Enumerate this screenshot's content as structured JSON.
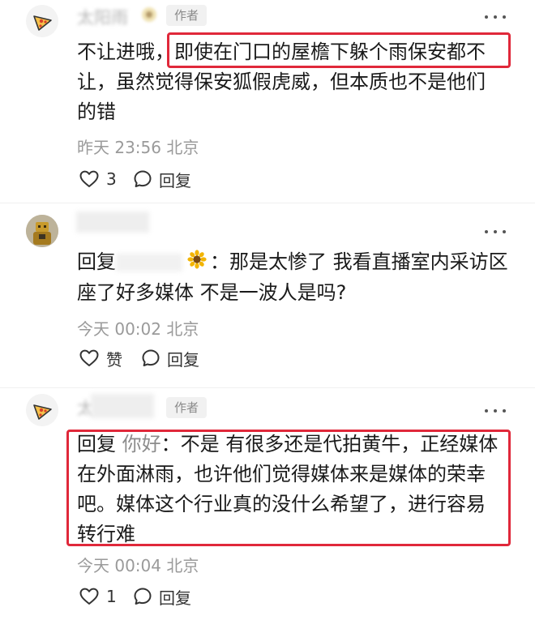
{
  "comments": [
    {
      "username": "太阳雨",
      "author_tag": "作者",
      "line1_prefix": "不让进哦，",
      "line1_highlight": "即使在门口的屋檐下躲个雨保安都不",
      "line2": "让，虽然觉得保安狐假虎威，但本质也不是他们",
      "line3": "的错",
      "timestamp": "昨天 23:56 北京",
      "like_count": "3",
      "reply_label": "回复"
    },
    {
      "reply_prefix": "回复",
      "line1_suffix": "：那是太惨了 我看直播室内采访区",
      "line2": "座了好多媒体 不是一波人是吗?",
      "timestamp": "今天 00:02 北京",
      "like_label": "赞",
      "reply_label": "回复"
    },
    {
      "username": "太",
      "author_tag": "作者",
      "reply_prefix": "回复",
      "reply_target": "你好",
      "line1_suffix": "：不是 有很多还是代拍黄牛，正经媒体",
      "line2": "在外面淋雨，也许他们觉得媒体来是媒体的荣幸",
      "line3": "吧。媒体这个行业真的没什么希望了，进行容易",
      "line4": "转行难",
      "timestamp": "今天 00:04 北京",
      "like_count": "1",
      "reply_label": "回复"
    }
  ],
  "icons": {
    "more": "more-dots-icon",
    "like": "heart-icon",
    "reply": "comment-bubble-icon",
    "sunflower": "sunflower-icon"
  },
  "colors": {
    "highlight_border": "#e0283a",
    "meta_text": "#9a9a9a"
  }
}
